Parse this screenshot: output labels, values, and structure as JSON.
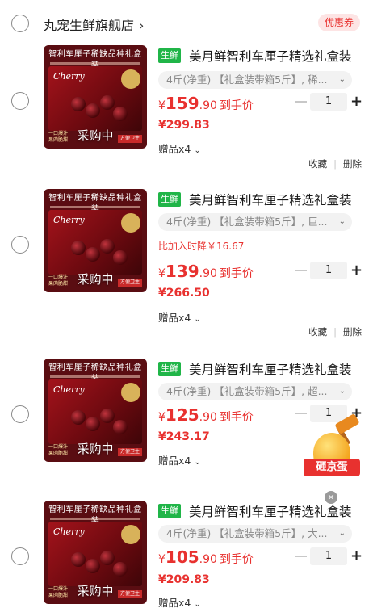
{
  "shop": {
    "name": "丸宠生鲜旗舰店",
    "chevron": "›",
    "coupon_label": "优惠券"
  },
  "thumbnail": {
    "top_text": "智利车厘子稀缺品种礼盒装",
    "brand": "Cherry",
    "slogan": "一口爆汁 果肉脆甜",
    "ribbon": "方便卫生",
    "overlay": "采购中"
  },
  "items": [
    {
      "tag": "生鲜",
      "title": "美月鲜智利车厘子精选礼盒装",
      "spec": "4斤(净重) 【礼盒装带箱5斤】, 稀...",
      "price_currency": "¥",
      "price_int": "159",
      "price_dec": ".90",
      "price_suffix": "到手价",
      "orig_price": "¥299.83",
      "gift": "赠品x4",
      "qty": "1",
      "action_fav": "收藏",
      "action_del": "删除"
    },
    {
      "tag": "生鲜",
      "title": "美月鲜智利车厘子精选礼盒装",
      "spec": "4斤(净重) 【礼盒装带箱5斤】, 巨...",
      "drop_note": "比加入时降￥16.67",
      "price_currency": "¥",
      "price_int": "139",
      "price_dec": ".90",
      "price_suffix": "到手价",
      "orig_price": "¥266.50",
      "gift": "赠品x4",
      "qty": "1",
      "action_fav": "收藏",
      "action_del": "删除"
    },
    {
      "tag": "生鲜",
      "title": "美月鲜智利车厘子精选礼盒装",
      "spec": "4斤(净重) 【礼盒装带箱5斤】, 超...",
      "price_currency": "¥",
      "price_int": "125",
      "price_dec": ".90",
      "price_suffix": "到手价",
      "orig_price": "¥243.17",
      "gift": "赠品x4",
      "qty": "1"
    },
    {
      "tag": "生鲜",
      "title": "美月鲜智利车厘子精选礼盒装",
      "spec": "4斤(净重) 【礼盒装带箱5斤】, 大...",
      "price_currency": "¥",
      "price_int": "105",
      "price_dec": ".90",
      "price_suffix": "到手价",
      "orig_price": "¥209.83",
      "gift": "赠品x4",
      "qty": "1"
    }
  ],
  "promo": {
    "label": "砸京蛋",
    "close": "×"
  },
  "icons": {
    "chevron_down": "chevron-down-icon",
    "plus": "plus-icon",
    "minus": "minus-icon"
  },
  "colors": {
    "accent_red": "#e8312f",
    "fresh_green": "#20b548"
  }
}
